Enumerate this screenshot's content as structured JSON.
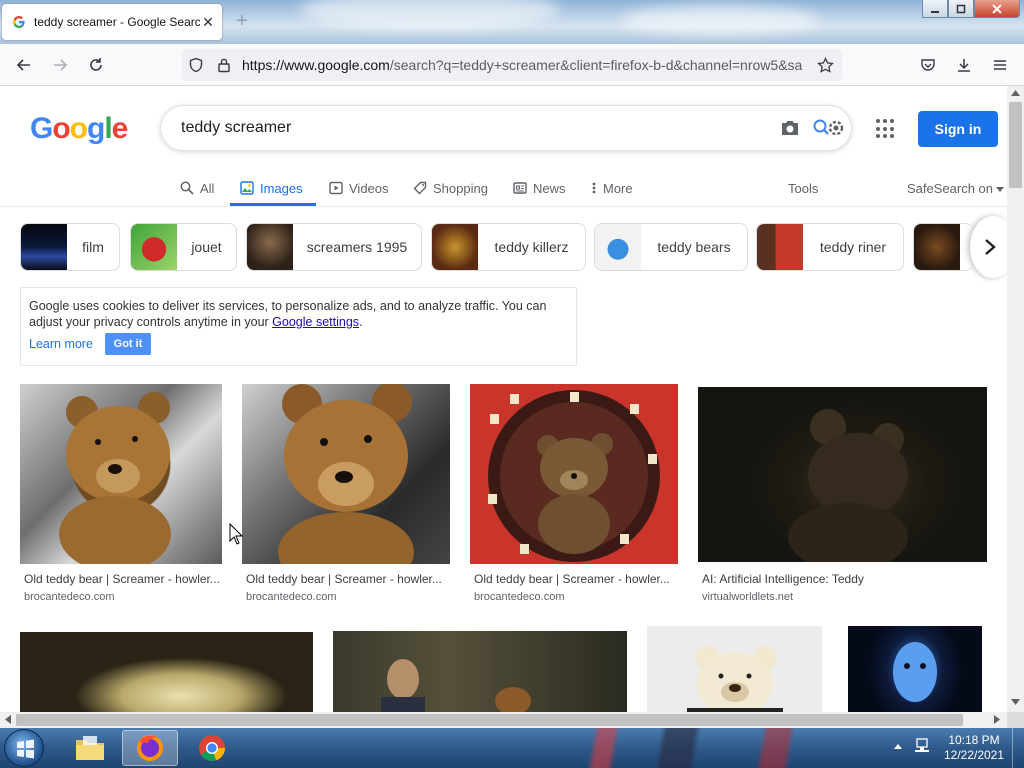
{
  "browser": {
    "tab_title": "teddy screamer - Google Search",
    "tab_close": "✕",
    "new_tab": "+",
    "url_host": "https://www.google.com",
    "url_rest": "/search?q=teddy+screamer&client=firefox-b-d&channel=nrow5&sa"
  },
  "google": {
    "logo": [
      "G",
      "o",
      "o",
      "g",
      "l",
      "e"
    ],
    "logo_colors": [
      "#4285f4",
      "#ea4335",
      "#fbbc05",
      "#4285f4",
      "#34a853",
      "#ea4335"
    ],
    "query": "teddy screamer",
    "sign_in": "Sign in",
    "tabs": [
      "All",
      "Images",
      "Videos",
      "Shopping",
      "News",
      "More"
    ],
    "tools": "Tools",
    "safesearch": "SafeSearch on",
    "chips": [
      "film",
      "jouet",
      "screamers 1995",
      "teddy killerz",
      "teddy bears",
      "teddy riner"
    ],
    "cookie": {
      "text": "Google uses cookies to deliver its services, to personalize ads, and to analyze traffic. You can adjust your privacy controls anytime in your ",
      "link": "Google settings",
      "after": ".",
      "learn_more": "Learn more",
      "got_it": "Got it"
    },
    "results": [
      {
        "title": "Old teddy bear | Screamer - howler...",
        "source": "brocantedeco.com"
      },
      {
        "title": "Old teddy bear | Screamer - howler...",
        "source": "brocantedeco.com"
      },
      {
        "title": "Old teddy bear | Screamer - howler...",
        "source": "brocantedeco.com"
      },
      {
        "title": "AI: Artificial Intelligence: Teddy",
        "source": "virtualworldlets.net"
      }
    ]
  },
  "taskbar": {
    "time": "10:18 PM",
    "date": "12/22/2021"
  }
}
